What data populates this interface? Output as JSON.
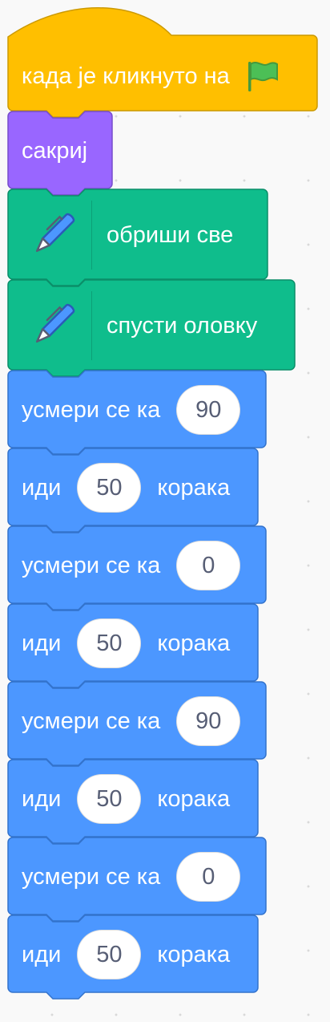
{
  "script": {
    "hat": {
      "label": "када је кликнуто на",
      "icon": "green-flag-icon"
    },
    "looks": {
      "label": "сакриј"
    },
    "pen_blocks": [
      {
        "label": "обриши све",
        "icon": "pen-icon"
      },
      {
        "label": "спусти оловку",
        "icon": "pen-icon"
      }
    ],
    "motion_blocks": [
      {
        "type": "point",
        "label": "усмери се ка",
        "value": "90"
      },
      {
        "type": "move",
        "label": "иди",
        "value": "50",
        "suffix": "корака"
      },
      {
        "type": "point",
        "label": "усмери се ка",
        "value": "0"
      },
      {
        "type": "move",
        "label": "иди",
        "value": "50",
        "suffix": "корака"
      },
      {
        "type": "point",
        "label": "усмери се ка",
        "value": "90"
      },
      {
        "type": "move",
        "label": "иди",
        "value": "50",
        "suffix": "корака"
      },
      {
        "type": "point",
        "label": "усмери се ка",
        "value": "0"
      },
      {
        "type": "move",
        "label": "иди",
        "value": "50",
        "suffix": "корака"
      }
    ]
  },
  "colors": {
    "events": "#ffbf00",
    "events_border": "#cc9900",
    "looks": "#9966ff",
    "looks_border": "#774dcb",
    "pen": "#0fbd8c",
    "pen_border": "#0b8e69",
    "motion": "#4c97ff",
    "motion_border": "#3373cc"
  }
}
